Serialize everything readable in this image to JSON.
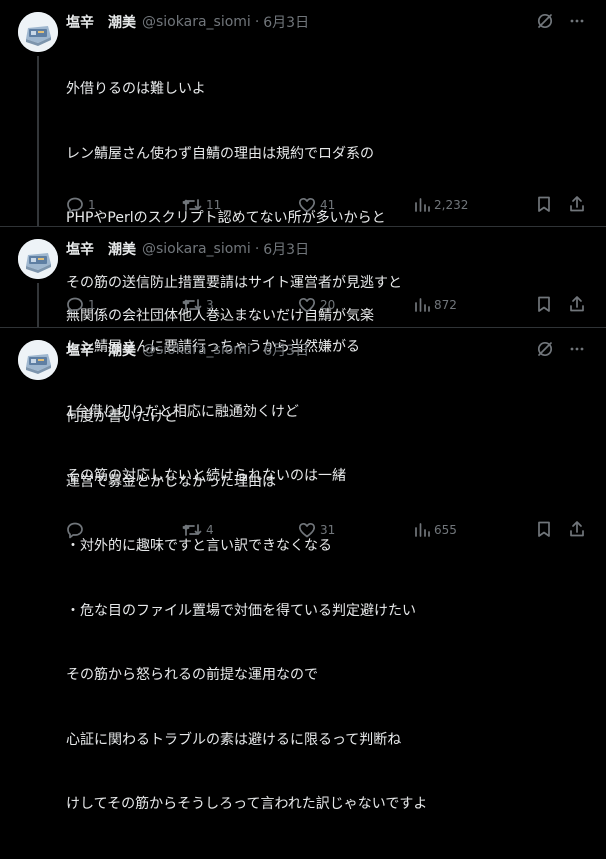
{
  "tweets": [
    {
      "display_name": "塩辛　潮美",
      "handle": "@siokara_siomi",
      "separator": "·",
      "date": "6月3日",
      "lines": [
        "外借りるのは難しいよ",
        "レン鯖屋さん使わず自鯖の理由は規約でロダ系の",
        "PHPやPerlのスクリプト認めてない所が多いからと",
        "その筋の送信防止措置要請はサイト運営者が見逃すと",
        "レン鯖屋さんに要請行っちゃうから当然嫌がる",
        "1台借り切りだと相応に融通効くけど",
        "その筋の対応しないと続けられないのは一緒"
      ],
      "stats": {
        "replies": "1",
        "retweets": "11",
        "likes": "41",
        "views": "2,232"
      }
    },
    {
      "display_name": "塩辛　潮美",
      "handle": "@siokara_siomi",
      "separator": "·",
      "date": "6月3日",
      "lines": [
        "無関係の会社団体他人巻込まないだけ自鯖が気楽"
      ],
      "stats": {
        "replies": "1",
        "retweets": "3",
        "likes": "20",
        "views": "872"
      }
    },
    {
      "display_name": "塩辛　潮美",
      "handle": "@siokara_siomi",
      "separator": "·",
      "date": "6月3日",
      "lines": [
        "何度か書いたけど",
        "運営で募金とかしなかった理由は",
        "・対外的に趣味ですと言い訳できなくなる",
        "・危な目のファイル置場で対価を得ている判定避けたい",
        "その筋から怒られるの前提な運用なので",
        "心証に関わるトラブルの素は避けるに限るって判断ね",
        "けしてその筋からそうしろって言われた訳じゃないですよ"
      ],
      "stats": {
        "replies": "",
        "retweets": "4",
        "likes": "31",
        "views": "655"
      }
    }
  ],
  "icons": {
    "grok": "grok-icon",
    "more": "more-icon",
    "reply": "reply-icon",
    "retweet": "retweet-icon",
    "like": "heart-icon",
    "views": "views-icon",
    "bookmark": "bookmark-icon",
    "share": "share-icon"
  },
  "colors": {
    "background": "#000000",
    "text": "#e7e9ea",
    "secondary": "#71767b",
    "divider": "#2f3336"
  }
}
